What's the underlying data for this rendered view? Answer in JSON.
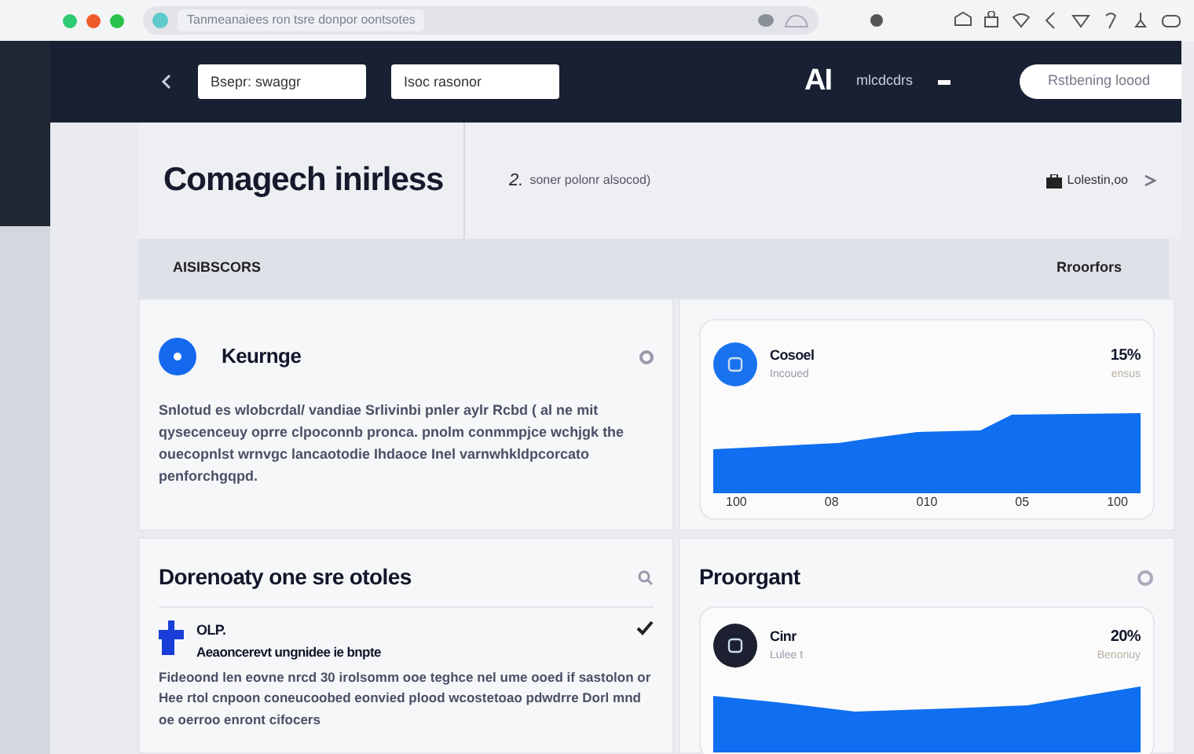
{
  "browser": {
    "address": "Tanmeanaiees ron tsre donpor oontsotes"
  },
  "navbar": {
    "search_fields": [
      {
        "value": "Bsepr: swaggr"
      },
      {
        "value": "Isoc rasonor"
      }
    ],
    "logo": "AI",
    "logo_caption": "mlcdcdrs",
    "button": "Rstbening loood"
  },
  "header": {
    "title": "Comagech inirless",
    "step": "2.",
    "subtitle": "soner polonr alsocod)",
    "account": "Lolestin,oo"
  },
  "section_bar": {
    "left": "AISIBSCORS",
    "right": "Rroorfors"
  },
  "cards": [
    {
      "kind": "text",
      "title": "Keurnge",
      "body": "Snlotud es wlobcrdal/ vandiae Srlivinbi pnler aylr Rcbd ( al ne mit qysecenceuy oprre clpoconnb pronca. pnolm conmmpjce wchjgk the ouecopnlst wrnvgc lancaotodie Ihdaoce Inel varnwhkldpcorcato penforchgqpd."
    },
    {
      "kind": "chart",
      "name": "Cosoel",
      "caption": "Incoued",
      "value": "15%",
      "value_caption": "ensus",
      "x_labels": [
        "100",
        "08",
        "010",
        "05",
        "100"
      ]
    },
    {
      "kind": "list",
      "title": "Dorenoaty one sre otoles",
      "items": [
        {
          "name": "OLP.",
          "subtitle": "Aeaoncerevt ungnidee ie bnpte",
          "body": "Fideoond len eovne nrcd 30 irolsomm ooe teghce nel ume ooed if sastolon or Hee rtol cnpoon coneucoobed eonvied plood wcostetoao pdwdrre Dorl mnd oe oerroo enront cifocers",
          "done": true
        }
      ]
    },
    {
      "kind": "chart",
      "title": "Proorgant",
      "name": "Cinr",
      "caption": "Lulee t",
      "value": "20%",
      "value_caption": "Benonuy"
    }
  ]
}
